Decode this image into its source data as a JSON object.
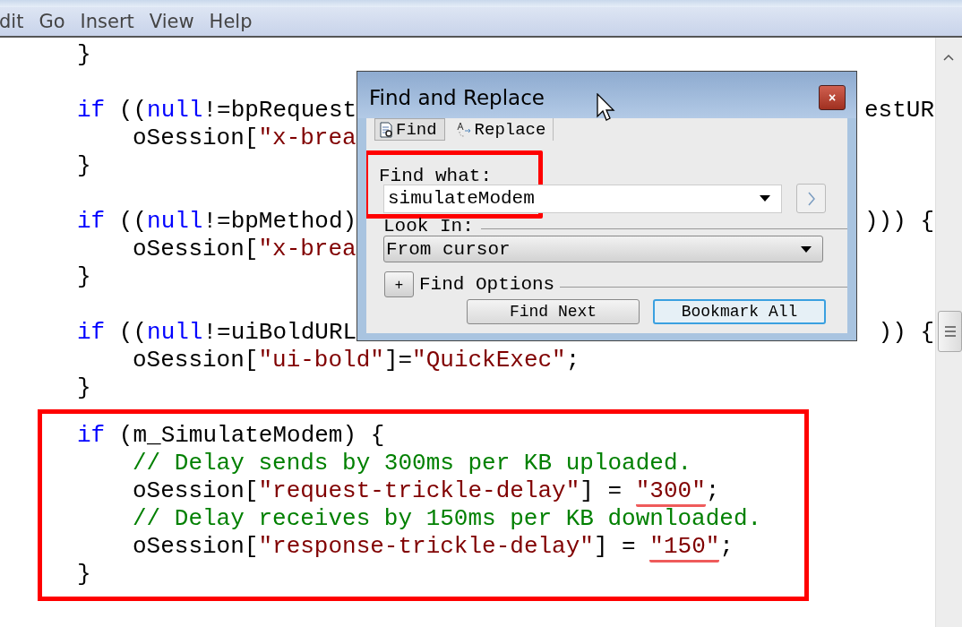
{
  "menu": [
    "dit",
    "Go",
    "Insert",
    "View",
    "Help"
  ],
  "editor": {
    "blocks": [
      {
        "framed": false,
        "lines": [
          {
            "kind": "code",
            "indented": false,
            "tokens": [
              {
                "kind": "plain",
                "text": "}"
              }
            ]
          },
          {
            "kind": "blank"
          },
          {
            "kind": "code",
            "indented": false,
            "tokens": [
              {
                "kind": "kw",
                "text": "if"
              },
              {
                "kind": "plain",
                "text": " (("
              },
              {
                "kind": "kw",
                "text": "null"
              },
              {
                "kind": "plain",
                "text": "!=bpRequest"
              }
            ],
            "tail": [
              {
                "kind": "plain",
                "text": "estUR"
              }
            ]
          },
          {
            "kind": "code",
            "indented": true,
            "tokens": [
              {
                "kind": "plain",
                "text": "oSession["
              },
              {
                "kind": "str",
                "text": "\"x-brea"
              }
            ]
          },
          {
            "kind": "code",
            "indented": false,
            "tokens": [
              {
                "kind": "plain",
                "text": "}"
              }
            ]
          },
          {
            "kind": "blank"
          },
          {
            "kind": "code",
            "indented": false,
            "tokens": [
              {
                "kind": "kw",
                "text": "if"
              },
              {
                "kind": "plain",
                "text": " (("
              },
              {
                "kind": "kw",
                "text": "null"
              },
              {
                "kind": "plain",
                "text": "!=bpMethod)"
              }
            ],
            "tail": [
              {
                "kind": "plain",
                "text": "))) {"
              }
            ]
          },
          {
            "kind": "code",
            "indented": true,
            "tokens": [
              {
                "kind": "plain",
                "text": "oSession["
              },
              {
                "kind": "str",
                "text": "\"x-brea"
              }
            ]
          },
          {
            "kind": "code",
            "indented": false,
            "tokens": [
              {
                "kind": "plain",
                "text": "}"
              }
            ]
          },
          {
            "kind": "blank"
          },
          {
            "kind": "code",
            "indented": false,
            "tokens": [
              {
                "kind": "kw",
                "text": "if"
              },
              {
                "kind": "plain",
                "text": " (("
              },
              {
                "kind": "kw",
                "text": "null"
              },
              {
                "kind": "plain",
                "text": "!=uiBoldURL"
              }
            ],
            "tail": [
              {
                "kind": "plain",
                "text": ")) {"
              }
            ]
          },
          {
            "kind": "code",
            "indented": true,
            "tokens": [
              {
                "kind": "plain",
                "text": "oSession["
              },
              {
                "kind": "str",
                "text": "\"ui-bold\""
              },
              {
                "kind": "plain",
                "text": "]="
              },
              {
                "kind": "str",
                "text": "\"QuickExec\""
              },
              {
                "kind": "plain",
                "text": ";"
              }
            ]
          },
          {
            "kind": "code",
            "indented": false,
            "tokens": [
              {
                "kind": "plain",
                "text": "}"
              }
            ]
          }
        ]
      },
      {
        "framed": true,
        "lines": [
          {
            "kind": "code",
            "indented": false,
            "tokens": [
              {
                "kind": "kw",
                "text": "if"
              },
              {
                "kind": "plain",
                "text": " (m_SimulateModem) {"
              }
            ]
          },
          {
            "kind": "code",
            "indented": true,
            "tokens": [
              {
                "kind": "cmt",
                "text": "// Delay sends by 300ms per KB uploaded."
              }
            ]
          },
          {
            "kind": "code",
            "indented": true,
            "tokens": [
              {
                "kind": "plain",
                "text": "oSession["
              },
              {
                "kind": "str",
                "text": "\"request-trickle-delay\""
              },
              {
                "kind": "plain",
                "text": "] = "
              },
              {
                "kind": "str",
                "text": "\"300\"",
                "underlined": true
              },
              {
                "kind": "plain",
                "text": ";"
              }
            ]
          },
          {
            "kind": "code",
            "indented": true,
            "tokens": [
              {
                "kind": "cmt",
                "text": "// Delay receives by 150ms per KB downloaded."
              }
            ]
          },
          {
            "kind": "code",
            "indented": true,
            "tokens": [
              {
                "kind": "plain",
                "text": "oSession["
              },
              {
                "kind": "str",
                "text": "\"response-trickle-delay\""
              },
              {
                "kind": "plain",
                "text": "] = "
              },
              {
                "kind": "str",
                "text": "\"150\"",
                "underlined": true
              },
              {
                "kind": "plain",
                "text": ";"
              }
            ]
          },
          {
            "kind": "code",
            "indented": false,
            "tokens": [
              {
                "kind": "plain",
                "text": "}"
              }
            ]
          }
        ]
      }
    ]
  },
  "dialog": {
    "title": "Find and Replace",
    "close": "×",
    "tabs": [
      {
        "label": "Find",
        "selected": true
      },
      {
        "label": "Replace",
        "selected": false
      }
    ],
    "find_what": {
      "label": "Find what:",
      "value": "simulateModem",
      "framed": true
    },
    "look_in": {
      "label": "Look In:",
      "value": "From cursor"
    },
    "options": {
      "toggle": "+",
      "label": "Find Options"
    },
    "buttons": [
      {
        "label": "Find Next",
        "default": false
      },
      {
        "label": "Bookmark All",
        "default": true
      }
    ]
  }
}
